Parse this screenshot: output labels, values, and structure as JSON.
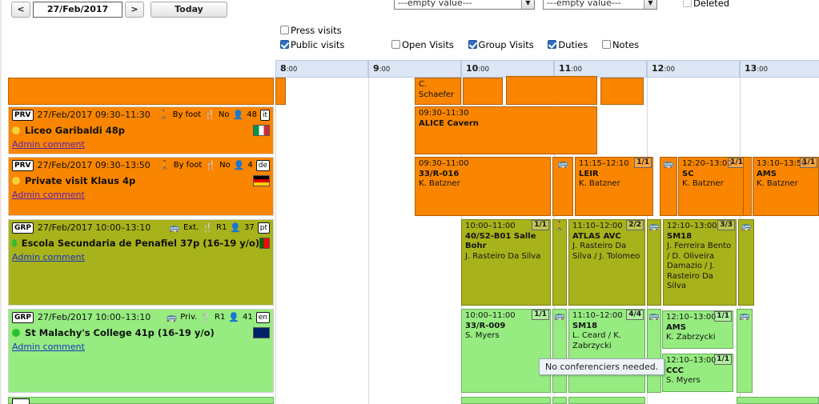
{
  "toolbar": {
    "prev_label": "<",
    "next_label": ">",
    "date_value": "27/Feb/2017",
    "today_label": "Today"
  },
  "filters": {
    "select_left": "---empty value---",
    "select_right": "---empty value---",
    "deleted_label": "Deleted",
    "deleted_checked": false,
    "press_visits_label": "Press visits",
    "press_visits_checked": false,
    "public_visits_label": "Public visits",
    "public_visits_checked": true,
    "open_visits_label": "Open Visits",
    "open_visits_checked": false,
    "group_visits_label": "Group Visits",
    "group_visits_checked": true,
    "duties_label": "Duties",
    "duties_checked": true,
    "notes_label": "Notes",
    "notes_checked": false
  },
  "time_header": [
    {
      "hour": "8",
      "minutes": ":00"
    },
    {
      "hour": "9",
      "minutes": ":00"
    },
    {
      "hour": "10",
      "minutes": ":00"
    },
    {
      "hour": "11",
      "minutes": ":00"
    },
    {
      "hour": "12",
      "minutes": ":00"
    },
    {
      "hour": "13",
      "minutes": ":00"
    }
  ],
  "colors": {
    "orange": "#f98500",
    "olive": "#a8b21a",
    "lightgreen": "#96ec80",
    "header_blue": "#dde6f5",
    "link_purple": "#5b1fb8",
    "link_blue": "#1a33c4"
  },
  "rows": [
    {
      "kind": "partial",
      "events": [
        {
          "person": "C. Schaefer"
        }
      ]
    },
    {
      "tag": "PRV",
      "date_range": "27/Feb/2017 09:30–11:30",
      "transport_icon": "walking-icon",
      "transport": "By foot",
      "meal_icon": "cutlery-icon",
      "meal": "No",
      "people_icon": "person-icon",
      "people": "48",
      "lang": "it",
      "flag": "italy-flag",
      "status_dot": "#f2d03a",
      "title": "Liceo Garibaldi",
      "title_suffix": "48p",
      "comment": "Admin comment",
      "events": [
        {
          "time": "09:30–11:30",
          "name": "ALICE Cavern",
          "person": ""
        }
      ]
    },
    {
      "tag": "PRV",
      "date_range": "27/Feb/2017 09:30–13:50",
      "transport_icon": "walking-icon",
      "transport": "By foot",
      "meal_icon": "cutlery-icon",
      "meal": "No",
      "people_icon": "person-icon",
      "people": "4",
      "lang": "de",
      "flag": "germany-flag",
      "status_dot": "#f2d03a",
      "title": "Private visit Klaus",
      "title_suffix": "4p",
      "comment": "Admin comment",
      "events": [
        {
          "time": "09:30–11:00",
          "name": "33/R-016",
          "person": "K. Batzner",
          "badge": ""
        },
        {
          "time": "11:15–12:10",
          "name": "LEIR",
          "person": "K. Batzner",
          "badge": "1/1"
        },
        {
          "time": "12:20–13:00",
          "name": "SC",
          "person": "K. Batzner",
          "badge": "1/1"
        },
        {
          "time": "13:10–13:50",
          "name": "AMS",
          "person": "K. Batzner",
          "badge": "1/1"
        }
      ]
    },
    {
      "tag": "GRP",
      "date_range": "27/Feb/2017 10:00–13:10",
      "transport_icon": "bus-icon",
      "transport": "Ext.",
      "meal_icon": "cutlery-icon",
      "meal": "R1",
      "people_icon": "person-icon",
      "people": "37",
      "lang": "pt",
      "flag": "portugal-flag",
      "status_dot": "#2fbf2f",
      "title": "Escola Secundaria de Penafiel",
      "title_suffix": "37p (16-19 y/o)",
      "comment": "Admin comment",
      "events": [
        {
          "time": "10:00–11:00",
          "name": "40/S2-B01 Salle Bohr",
          "person": "J. Rasteiro Da Silva",
          "badge": "1/1"
        },
        {
          "time": "11:10–12:00",
          "name": "ATLAS AVC",
          "person": "J. Rasteiro Da Silva / J. Tolomeo",
          "badge": "2/2"
        },
        {
          "time": "12:10–13:00",
          "name": "SM18",
          "person": "J. Ferreira Bento / D. Oliveira Damazio / J. Rasteiro Da Silva",
          "badge": "3/3"
        }
      ]
    },
    {
      "tag": "GRP",
      "date_range": "27/Feb/2017 10:00–13:10",
      "transport_icon": "bus-icon",
      "transport": "Priv.",
      "meal_icon": "cutlery-icon",
      "meal": "R1",
      "people_icon": "person-icon",
      "people": "41",
      "lang": "en",
      "flag": "uk-flag",
      "status_dot": "#2fbf2f",
      "title": "St Malachy's College",
      "title_suffix": "41p (16-19 y/o)",
      "comment": "Admin comment",
      "events": [
        {
          "time": "10:00–11:00",
          "name": "33/R-009",
          "person": "S. Myers",
          "badge": "1/1"
        },
        {
          "time": "11:10–12:00",
          "name": "SM18",
          "person": "L. Ceard / K. Zabrzycki",
          "badge": "4/4"
        },
        {
          "time": "12:10–13:00",
          "name": "AMS",
          "person": "K. Zabrzycki",
          "badge": "1/1"
        },
        {
          "time": "12:10–13:00",
          "name": "CCC",
          "person": "S. Myers",
          "badge": "1/1"
        }
      ]
    }
  ],
  "tooltip": {
    "text": "No conferenciers needed."
  }
}
